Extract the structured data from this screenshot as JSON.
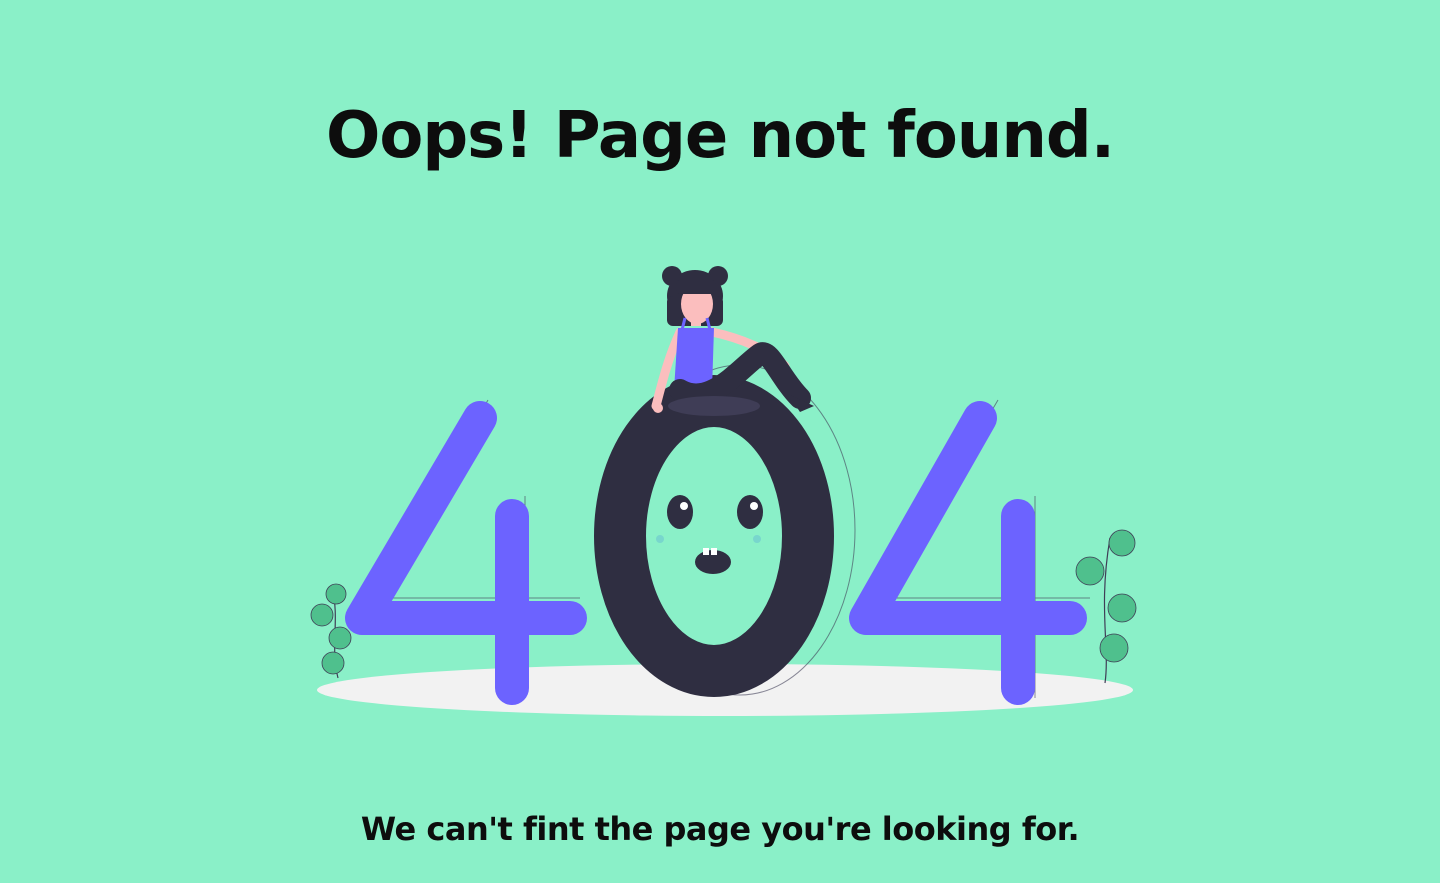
{
  "page": {
    "title": "Oops! Page not found.",
    "subtitle": "We can't fint the page you're looking for."
  },
  "illustration": {
    "icon": "404-illustration",
    "digits": [
      "4",
      "0",
      "4"
    ]
  },
  "colors": {
    "background": "#8af0c8",
    "digit_four": "#6c63ff",
    "digit_zero": "#2f2e41",
    "ground": "#f2f2f2",
    "plant": "#4fc08d",
    "text": "#0d0d0d"
  }
}
